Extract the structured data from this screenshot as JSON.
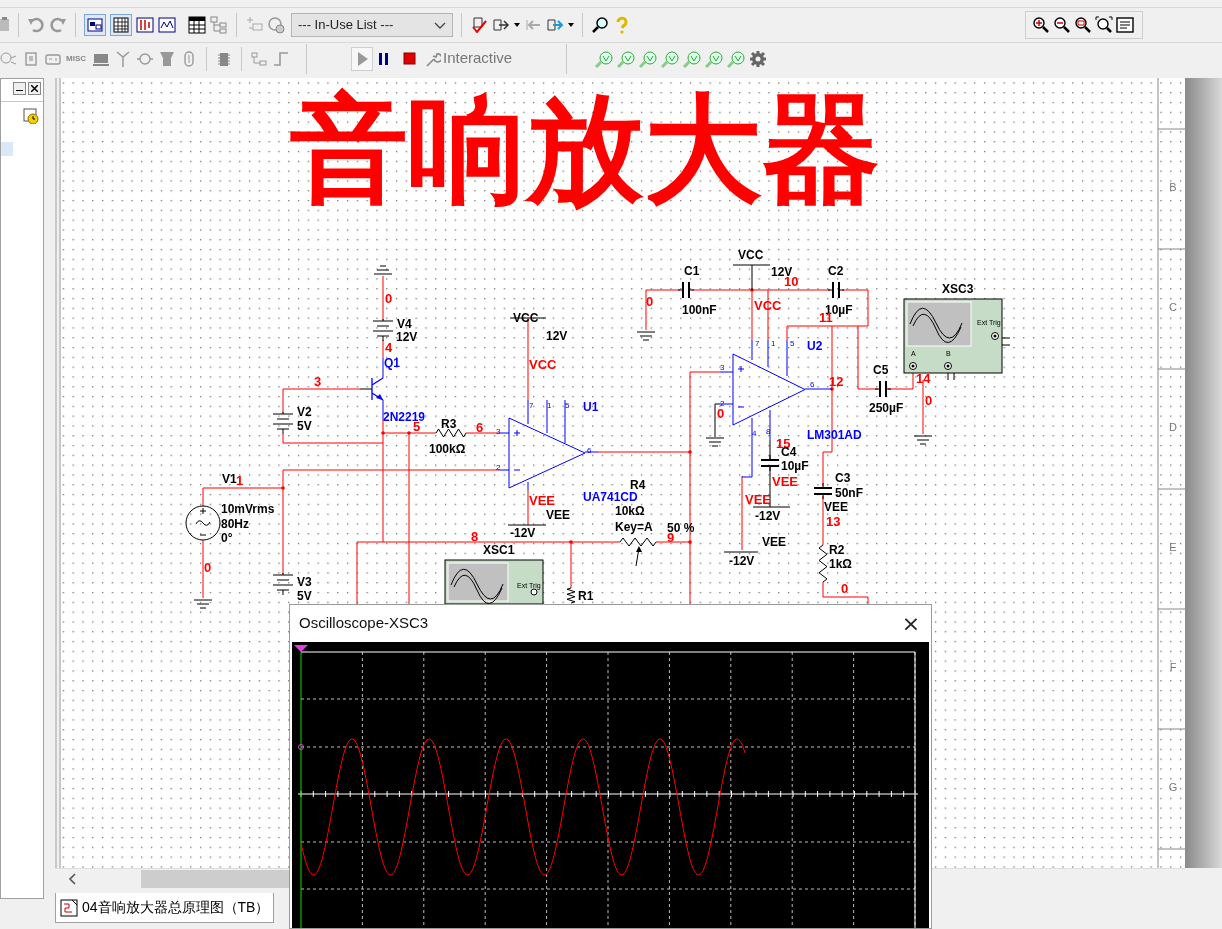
{
  "toolbar": {
    "in_use_list": "--- In-Use List ---",
    "misc_label": "MISC",
    "simulation_mode": "Interactive"
  },
  "schematic": {
    "title": "音响放大器",
    "labels": [
      {
        "text": "0",
        "kind": "net"
      },
      {
        "text": "V4",
        "kind": "ref"
      },
      {
        "text": "12V",
        "kind": "ref"
      },
      {
        "text": "4",
        "kind": "net"
      },
      {
        "text": "Q1",
        "kind": "part"
      },
      {
        "text": "3",
        "kind": "net"
      },
      {
        "text": "V2",
        "kind": "ref"
      },
      {
        "text": "5V",
        "kind": "ref"
      },
      {
        "text": "2N2219",
        "kind": "part"
      },
      {
        "text": "5",
        "kind": "net"
      },
      {
        "text": "V1",
        "kind": "ref"
      },
      {
        "text": "1",
        "kind": "net"
      },
      {
        "text": "10mVrms",
        "kind": "ref"
      },
      {
        "text": "80Hz",
        "kind": "ref"
      },
      {
        "text": "0°",
        "kind": "ref"
      },
      {
        "text": "0",
        "kind": "net"
      },
      {
        "text": "V3",
        "kind": "ref"
      },
      {
        "text": "5V",
        "kind": "ref"
      },
      {
        "text": "R3",
        "kind": "ref"
      },
      {
        "text": "100kΩ",
        "kind": "ref"
      },
      {
        "text": "6",
        "kind": "net"
      },
      {
        "text": "VCC",
        "kind": "ref"
      },
      {
        "text": "12V",
        "kind": "ref"
      },
      {
        "text": "VCC",
        "kind": "net"
      },
      {
        "text": "7",
        "kind": "pin"
      },
      {
        "text": "1",
        "kind": "pin"
      },
      {
        "text": "5",
        "kind": "pin"
      },
      {
        "text": "U1",
        "kind": "part"
      },
      {
        "text": "3",
        "kind": "pin"
      },
      {
        "text": "2",
        "kind": "pin"
      },
      {
        "text": "6",
        "kind": "pin"
      },
      {
        "text": "VEE",
        "kind": "net"
      },
      {
        "text": "VEE",
        "kind": "ref"
      },
      {
        "text": "UA741CD",
        "kind": "part"
      },
      {
        "text": "-12V",
        "kind": "ref"
      },
      {
        "text": "R4",
        "kind": "ref"
      },
      {
        "text": "10kΩ",
        "kind": "ref"
      },
      {
        "text": "Key=A",
        "kind": "ref"
      },
      {
        "text": "50 %",
        "kind": "ref"
      },
      {
        "text": "8",
        "kind": "net"
      },
      {
        "text": "9",
        "kind": "net"
      },
      {
        "text": "XSC1",
        "kind": "ref"
      },
      {
        "text": "Ext Trig",
        "kind": "tiny"
      },
      {
        "text": "R1",
        "kind": "ref"
      },
      {
        "text": "C1",
        "kind": "ref"
      },
      {
        "text": "100nF",
        "kind": "ref"
      },
      {
        "text": "0",
        "kind": "net"
      },
      {
        "text": "VCC",
        "kind": "ref"
      },
      {
        "text": "12V",
        "kind": "ref"
      },
      {
        "text": "VCC",
        "kind": "net"
      },
      {
        "text": "10",
        "kind": "net"
      },
      {
        "text": "7",
        "kind": "pin"
      },
      {
        "text": "1",
        "kind": "pin"
      },
      {
        "text": "5",
        "kind": "pin"
      },
      {
        "text": "U2",
        "kind": "part"
      },
      {
        "text": "3",
        "kind": "pin"
      },
      {
        "text": "2",
        "kind": "pin"
      },
      {
        "text": "6",
        "kind": "pin"
      },
      {
        "text": "4",
        "kind": "pin"
      },
      {
        "text": "8",
        "kind": "pin"
      },
      {
        "text": "0",
        "kind": "net"
      },
      {
        "text": "12",
        "kind": "net"
      },
      {
        "text": "15",
        "kind": "net"
      },
      {
        "text": "C4",
        "kind": "ref"
      },
      {
        "text": "10µF",
        "kind": "ref"
      },
      {
        "text": "VEE",
        "kind": "net"
      },
      {
        "text": "VEE",
        "kind": "net"
      },
      {
        "text": "LM301AD",
        "kind": "part"
      },
      {
        "text": "-12V",
        "kind": "ref"
      },
      {
        "text": "VEE",
        "kind": "ref"
      },
      {
        "text": "-12V",
        "kind": "ref"
      },
      {
        "text": "C2",
        "kind": "ref"
      },
      {
        "text": "10µF",
        "kind": "ref"
      },
      {
        "text": "11",
        "kind": "net"
      },
      {
        "text": "C3",
        "kind": "ref"
      },
      {
        "text": "50nF",
        "kind": "ref"
      },
      {
        "text": "VEE",
        "kind": "ref"
      },
      {
        "text": "13",
        "kind": "net"
      },
      {
        "text": "R2",
        "kind": "ref"
      },
      {
        "text": "1kΩ",
        "kind": "ref"
      },
      {
        "text": "0",
        "kind": "net"
      },
      {
        "text": "C5",
        "kind": "ref"
      },
      {
        "text": "250µF",
        "kind": "ref"
      },
      {
        "text": "XSC3",
        "kind": "ref"
      },
      {
        "text": "Ext Trig",
        "kind": "tiny"
      },
      {
        "text": "A",
        "kind": "tiny"
      },
      {
        "text": "B",
        "kind": "tiny"
      },
      {
        "text": "14",
        "kind": "net"
      },
      {
        "text": "0",
        "kind": "net"
      }
    ],
    "border_rows": [
      "B",
      "C",
      "D",
      "E",
      "F",
      "G"
    ]
  },
  "oscilloscope_window": {
    "title": "Oscilloscope-XSC3",
    "close": "×"
  },
  "sheet_tabs": [
    {
      "label": "04音响放大器总原理图（TB）",
      "selected": true
    }
  ]
}
